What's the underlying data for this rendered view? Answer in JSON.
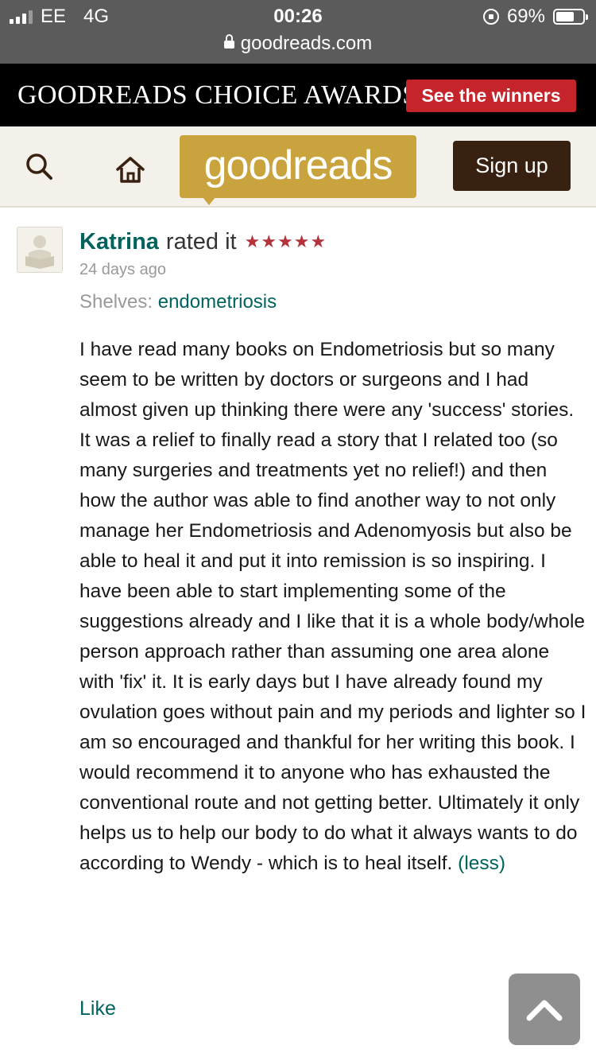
{
  "status_bar": {
    "carrier": "EE",
    "network": "4G",
    "time": "00:26",
    "battery": "69%",
    "battery_level": 0.69,
    "url": "goodreads.com"
  },
  "banner": {
    "title": "GOODREADS CHOICE AWARDS",
    "button_label": "See the winners",
    "button_color": "#c5242b"
  },
  "nav": {
    "logo": "goodreads",
    "signup_label": "Sign up",
    "icons": [
      "search-icon",
      "home-icon"
    ]
  },
  "review": {
    "reviewer": "Katrina",
    "rated_text": "rated it",
    "rating": 5,
    "stars": [
      "★",
      "★",
      "★",
      "★",
      "★"
    ],
    "date": "24 days ago",
    "shelves_label": "Shelves:",
    "shelf": "endometriosis",
    "body": "I have read many books on Endometriosis but so many seem to be written by doctors or surgeons and I had almost given up thinking there were any 'success' stories. It was a relief to finally read a story that I related too (so many surgeries and treatments yet no relief!) and then how the author was able to find another way to not only manage her Endometriosis and Adenomyosis but also be able to heal it and put it into remission is so inspiring. I have been able to start implementing some of the suggestions already and I like that it is a whole body/whole person approach rather than assuming one area alone with 'fix' it. It is early days but I have already found my ovulation goes without pain and my periods and lighter so I am so encouraged and thankful for her writing this book. I would recommend it to anyone who has exhausted the conventional route and not getting better. Ultimately it only helps us to help our body to do what it always wants to do according to Wendy - which is to heal itself.",
    "less_label": "(less)",
    "like_label": "Like"
  },
  "colors": {
    "link": "#00635d",
    "star": "#b4333a",
    "logo_bg": "#c9a33e",
    "signup_bg": "#382110"
  }
}
